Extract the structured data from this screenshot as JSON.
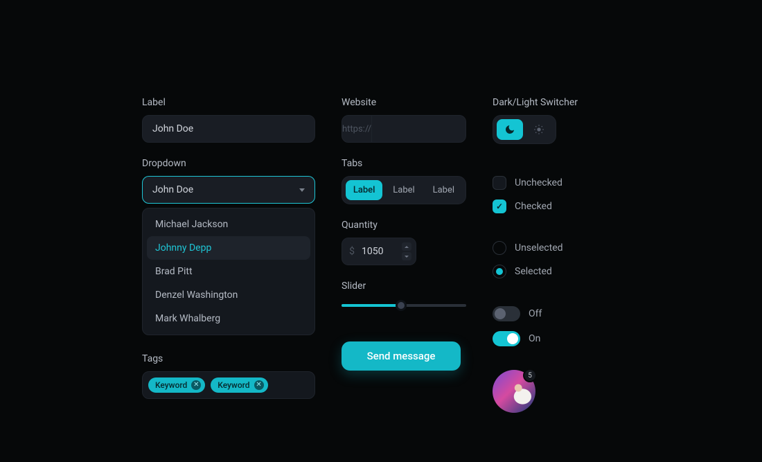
{
  "col1": {
    "label_title": "Label",
    "label_value": "John Doe",
    "dropdown_title": "Dropdown",
    "dropdown_selected": "John Doe",
    "dropdown_items": [
      "Michael Jackson",
      "Johnny Depp",
      "Brad Pitt",
      "Denzel Washington",
      "Mark Whalberg"
    ],
    "dropdown_active_index": 1,
    "tags_title": "Tags",
    "tags": [
      "Keyword",
      "Keyword"
    ]
  },
  "col2": {
    "website_title": "Website",
    "website_prefix": "https://",
    "website_value": "",
    "tabs_title": "Tabs",
    "tabs": [
      "Label",
      "Label",
      "Label"
    ],
    "tabs_active": 0,
    "quantity_title": "Quantity",
    "quantity_prefix": "$",
    "quantity_value": "1050",
    "slider_title": "Slider",
    "slider_percent": 48,
    "send_label": "Send message"
  },
  "col3": {
    "switcher_title": "Dark/Light Switcher",
    "check_unchecked": "Unchecked",
    "check_checked": "Checked",
    "radio_unselected": "Unselected",
    "radio_selected": "Selected",
    "toggle_off": "Off",
    "toggle_on": "On",
    "avatar_badge": "5"
  }
}
